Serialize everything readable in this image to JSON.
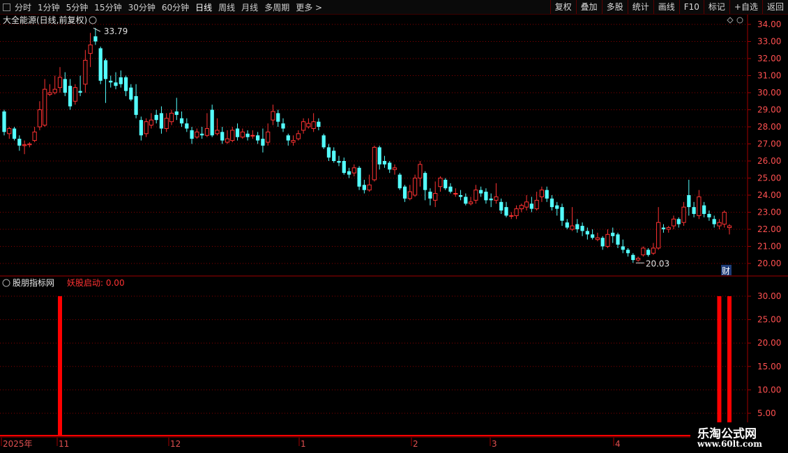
{
  "toolbar": {
    "periods": [
      "分时",
      "1分钟",
      "5分钟",
      "15分钟",
      "30分钟",
      "60分钟",
      "日线",
      "周线",
      "月线",
      "多周期",
      "更多 >"
    ],
    "active_period": "日线",
    "right_buttons": [
      "复权",
      "叠加",
      "多股",
      "统计",
      "画线",
      "F10",
      "标记",
      "+自选",
      "返回"
    ]
  },
  "main_panel": {
    "title": "大全能源(日线,前复权)",
    "high_label": "33.79",
    "low_label": "20.03",
    "cai_badge": "财",
    "y_ticks": [
      "34.00",
      "33.00",
      "32.00",
      "31.00",
      "30.00",
      "29.00",
      "28.00",
      "27.00",
      "26.00",
      "25.00",
      "24.00",
      "23.00",
      "22.00",
      "21.00",
      "20.00"
    ]
  },
  "indicator_panel": {
    "name": "股朋指标网",
    "series_label": "妖股启动: 0.00",
    "y_ticks": [
      "30.00",
      "25.00",
      "20.00",
      "15.00",
      "10.00",
      "5.00"
    ]
  },
  "x_axis": {
    "labels": [
      "2025年",
      "11",
      "12",
      "1",
      "2",
      "3",
      "4"
    ]
  },
  "watermark": {
    "line1": "乐淘公式网",
    "line2": "www.60lt.com"
  },
  "colors": {
    "up": "#ff3232",
    "down": "#54ffff",
    "signal": "#ff0000",
    "grid": "#8b0000"
  },
  "chart_data": {
    "type": "candlestick",
    "price_range": [
      20.0,
      34.0
    ],
    "candles": [
      [
        28.9,
        27.7,
        29.0,
        27.5
      ],
      [
        27.6,
        27.9,
        28.0,
        27.3
      ],
      [
        27.9,
        27.3,
        28.0,
        27.2
      ],
      [
        27.3,
        26.9,
        27.5,
        26.6
      ],
      [
        26.9,
        26.95,
        27.2,
        26.4
      ],
      [
        26.95,
        27.0,
        27.1,
        26.8
      ],
      [
        27.2,
        27.7,
        28.0,
        27.1
      ],
      [
        28.0,
        29.0,
        29.5,
        27.8
      ],
      [
        28.1,
        30.2,
        30.8,
        28.0
      ],
      [
        29.9,
        30.0,
        30.5,
        29.8
      ],
      [
        30.0,
        30.2,
        31.0,
        29.9
      ],
      [
        30.3,
        30.9,
        31.5,
        30.0
      ],
      [
        30.8,
        30.0,
        31.2,
        29.8
      ],
      [
        30.4,
        29.2,
        30.8,
        29.0
      ],
      [
        29.5,
        30.3,
        30.5,
        29.3
      ],
      [
        30.1,
        30.0,
        31.0,
        29.8
      ],
      [
        30.5,
        31.9,
        32.5,
        30.0
      ],
      [
        32.3,
        32.8,
        33.5,
        31.5
      ],
      [
        33.3,
        33.0,
        33.79,
        32.8
      ],
      [
        32.6,
        30.7,
        32.7,
        30.5
      ],
      [
        31.9,
        30.8,
        32.0,
        29.4
      ],
      [
        30.7,
        30.6,
        31.0,
        30.3
      ],
      [
        30.6,
        30.4,
        31.2,
        30.2
      ],
      [
        30.9,
        30.5,
        31.3,
        30.3
      ],
      [
        30.9,
        30.1,
        31.0,
        29.8
      ],
      [
        30.3,
        29.6,
        30.5,
        29.5
      ],
      [
        29.8,
        28.7,
        30.5,
        28.5
      ],
      [
        28.4,
        27.5,
        28.6,
        27.2
      ],
      [
        27.6,
        28.3,
        28.5,
        27.4
      ],
      [
        28.1,
        28.4,
        28.8,
        27.9
      ],
      [
        28.7,
        28.4,
        29.0,
        28.2
      ],
      [
        28.8,
        27.9,
        29.2,
        27.6
      ],
      [
        27.9,
        28.5,
        28.8,
        27.7
      ],
      [
        28.3,
        28.8,
        29.0,
        28.1
      ],
      [
        28.9,
        28.7,
        29.7,
        28.4
      ],
      [
        28.5,
        28.2,
        28.9,
        28.0
      ],
      [
        28.2,
        27.9,
        28.5,
        27.7
      ],
      [
        27.8,
        27.3,
        28.0,
        27.0
      ],
      [
        27.4,
        27.7,
        27.9,
        27.3
      ],
      [
        27.6,
        27.5,
        28.0,
        27.3
      ],
      [
        27.5,
        27.9,
        28.8,
        27.4
      ],
      [
        29.0,
        27.5,
        29.3,
        27.4
      ],
      [
        27.6,
        27.8,
        28.5,
        27.5
      ],
      [
        27.7,
        27.2,
        28.0,
        27.0
      ],
      [
        27.1,
        27.3,
        27.8,
        27.0
      ],
      [
        27.2,
        27.8,
        28.0,
        27.1
      ],
      [
        27.9,
        27.4,
        28.2,
        27.2
      ],
      [
        27.4,
        27.7,
        27.9,
        27.3
      ],
      [
        27.6,
        27.4,
        27.8,
        27.2
      ],
      [
        27.5,
        27.5,
        27.8,
        27.3
      ],
      [
        27.5,
        27.2,
        27.7,
        27.0
      ],
      [
        27.3,
        26.9,
        27.9,
        26.5
      ],
      [
        27.1,
        27.7,
        28.2,
        26.9
      ],
      [
        28.4,
        28.9,
        29.3,
        28.1
      ],
      [
        28.8,
        28.3,
        29.0,
        28.0
      ],
      [
        28.2,
        27.9,
        28.5,
        27.7
      ],
      [
        27.5,
        27.2,
        27.6,
        26.9
      ],
      [
        27.1,
        27.2,
        27.5,
        26.9
      ],
      [
        27.3,
        27.6,
        27.8,
        27.2
      ],
      [
        27.8,
        28.3,
        28.5,
        27.6
      ],
      [
        28.0,
        28.2,
        28.5,
        27.9
      ],
      [
        27.9,
        28.3,
        28.8,
        27.7
      ],
      [
        28.3,
        28.0,
        28.5,
        27.8
      ],
      [
        27.5,
        26.8,
        27.6,
        26.7
      ],
      [
        26.8,
        26.2,
        27.0,
        26.0
      ],
      [
        26.6,
        26.0,
        26.8,
        25.9
      ],
      [
        26.0,
        25.9,
        26.3,
        25.7
      ],
      [
        26.0,
        25.3,
        26.2,
        25.2
      ],
      [
        25.4,
        25.2,
        25.6,
        25.0
      ],
      [
        25.3,
        25.6,
        25.8,
        25.1
      ],
      [
        25.6,
        24.5,
        25.7,
        24.3
      ],
      [
        24.6,
        24.3,
        24.9,
        24.1
      ],
      [
        24.3,
        24.6,
        25.2,
        24.2
      ],
      [
        24.9,
        26.8,
        26.9,
        24.8
      ],
      [
        26.8,
        25.8,
        26.9,
        25.5
      ],
      [
        26.0,
        25.8,
        26.3,
        25.6
      ],
      [
        25.9,
        25.5,
        26.0,
        25.3
      ],
      [
        25.5,
        25.6,
        25.8,
        25.2
      ],
      [
        25.2,
        24.4,
        25.3,
        24.3
      ],
      [
        24.5,
        23.8,
        24.6,
        23.6
      ],
      [
        23.8,
        24.2,
        24.6,
        23.7
      ],
      [
        24.0,
        25.0,
        25.2,
        23.9
      ],
      [
        25.0,
        25.8,
        26.0,
        24.5
      ],
      [
        25.3,
        24.3,
        25.4,
        23.7
      ],
      [
        24.2,
        23.8,
        24.4,
        23.4
      ],
      [
        23.7,
        24.1,
        24.8,
        23.3
      ],
      [
        24.5,
        25.0,
        25.1,
        24.2
      ],
      [
        24.9,
        24.4,
        25.0,
        24.3
      ],
      [
        24.5,
        24.2,
        24.7,
        24.1
      ],
      [
        24.1,
        24.1,
        24.4,
        23.9
      ],
      [
        24.0,
        23.9,
        24.3,
        23.7
      ],
      [
        23.9,
        23.5,
        24.1,
        23.4
      ],
      [
        23.5,
        23.6,
        23.9,
        23.4
      ],
      [
        23.7,
        24.3,
        24.6,
        23.5
      ],
      [
        24.3,
        24.1,
        24.5,
        23.9
      ],
      [
        24.2,
        23.7,
        24.4,
        23.5
      ],
      [
        23.8,
        23.7,
        24.1,
        23.3
      ],
      [
        23.7,
        23.9,
        24.7,
        23.5
      ],
      [
        23.6,
        23.1,
        23.8,
        22.9
      ],
      [
        23.3,
        22.8,
        23.6,
        22.7
      ],
      [
        22.8,
        22.8,
        23.0,
        22.6
      ],
      [
        22.8,
        23.2,
        23.4,
        22.6
      ],
      [
        23.2,
        23.4,
        23.5,
        23.0
      ],
      [
        23.3,
        23.6,
        24.0,
        23.1
      ],
      [
        23.5,
        23.2,
        23.9,
        23.0
      ],
      [
        23.2,
        23.7,
        24.2,
        23.1
      ],
      [
        23.9,
        24.3,
        24.5,
        23.6
      ],
      [
        24.3,
        23.8,
        24.5,
        23.6
      ],
      [
        23.8,
        23.3,
        24.0,
        23.1
      ],
      [
        23.4,
        23.2,
        23.6,
        22.8
      ],
      [
        23.3,
        22.5,
        23.5,
        22.2
      ],
      [
        22.4,
        22.1,
        22.6,
        22.0
      ],
      [
        22.0,
        22.2,
        23.3,
        21.9
      ],
      [
        22.3,
        22.0,
        22.6,
        21.8
      ],
      [
        22.2,
        21.9,
        22.4,
        21.6
      ],
      [
        21.9,
        21.7,
        22.1,
        21.4
      ],
      [
        21.7,
        21.5,
        22.0,
        21.4
      ],
      [
        21.4,
        21.5,
        21.8,
        21.3
      ],
      [
        21.5,
        21.0,
        21.6,
        20.8
      ],
      [
        21.0,
        21.7,
        22.0,
        20.9
      ],
      [
        21.8,
        21.6,
        22.1,
        21.2
      ],
      [
        21.7,
        21.1,
        21.8,
        20.9
      ],
      [
        21.0,
        20.8,
        21.4,
        20.6
      ],
      [
        20.8,
        20.6,
        20.9,
        20.4
      ],
      [
        20.5,
        20.2,
        20.6,
        20.03
      ],
      [
        20.2,
        20.3,
        20.4,
        20.1
      ],
      [
        20.5,
        20.9,
        21.0,
        20.4
      ],
      [
        20.8,
        20.5,
        20.9,
        20.4
      ],
      [
        20.6,
        20.9,
        21.2,
        20.5
      ],
      [
        20.9,
        22.4,
        23.3,
        20.8
      ],
      [
        22.1,
        22.0,
        22.3,
        21.8
      ],
      [
        22.0,
        22.1,
        22.2,
        21.8
      ],
      [
        22.2,
        22.6,
        22.8,
        22.0
      ],
      [
        22.6,
        22.3,
        22.7,
        22.1
      ],
      [
        22.4,
        23.3,
        23.6,
        22.2
      ],
      [
        24.0,
        23.3,
        24.9,
        22.8
      ],
      [
        23.3,
        22.9,
        23.6,
        22.7
      ],
      [
        22.8,
        23.9,
        24.3,
        22.6
      ],
      [
        23.4,
        22.9,
        23.6,
        22.7
      ],
      [
        22.9,
        22.7,
        23.1,
        22.5
      ],
      [
        22.6,
        22.3,
        22.8,
        22.1
      ],
      [
        22.2,
        22.4,
        22.6,
        22.0
      ],
      [
        22.3,
        23.0,
        23.1,
        22.1
      ],
      [
        22.1,
        22.2,
        22.3,
        21.7
      ]
    ],
    "indicator_bars": [
      {
        "index": 11,
        "value": 30.0
      },
      {
        "index": 141,
        "value": 30.0
      },
      {
        "index": 143,
        "value": 30.0
      }
    ]
  }
}
